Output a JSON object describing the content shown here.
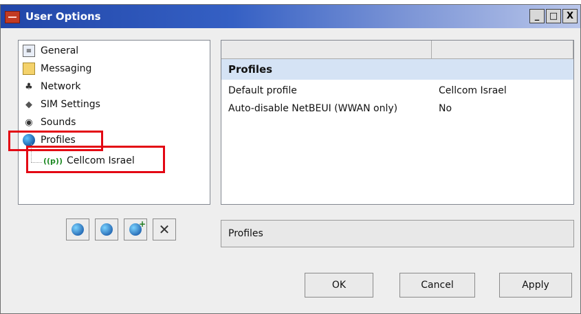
{
  "window": {
    "title": "User Options",
    "controls": {
      "minimize": "_",
      "maximize": "□",
      "close": "X"
    }
  },
  "tree": {
    "items": [
      {
        "label": "General",
        "icon": "general-icon"
      },
      {
        "label": "Messaging",
        "icon": "envelope-icon"
      },
      {
        "label": "Network",
        "icon": "network-icon"
      },
      {
        "label": "SIM Settings",
        "icon": "sim-card-icon"
      },
      {
        "label": "Sounds",
        "icon": "speaker-icon"
      },
      {
        "label": "Profiles",
        "icon": "globe-icon"
      }
    ],
    "child": {
      "label": "Cellcom Israel",
      "icon": "signal-antenna-icon",
      "glyph": "((p))"
    },
    "highlight_color": "#e30613"
  },
  "grid": {
    "section": "Profiles",
    "rows": [
      {
        "key": "Default profile",
        "value": "Cellcom Israel"
      },
      {
        "key": "Auto-disable NetBEUI (WWAN only)",
        "value": "No"
      }
    ]
  },
  "toolbar": {
    "buttons": [
      {
        "icon": "profile-edit-icon"
      },
      {
        "icon": "profile-copy-icon"
      },
      {
        "icon": "profile-add-icon"
      },
      {
        "icon": "delete-icon",
        "glyph": "✕"
      }
    ]
  },
  "status_text": "Profiles",
  "buttons": {
    "ok": "OK",
    "cancel": "Cancel",
    "apply": "Apply"
  }
}
